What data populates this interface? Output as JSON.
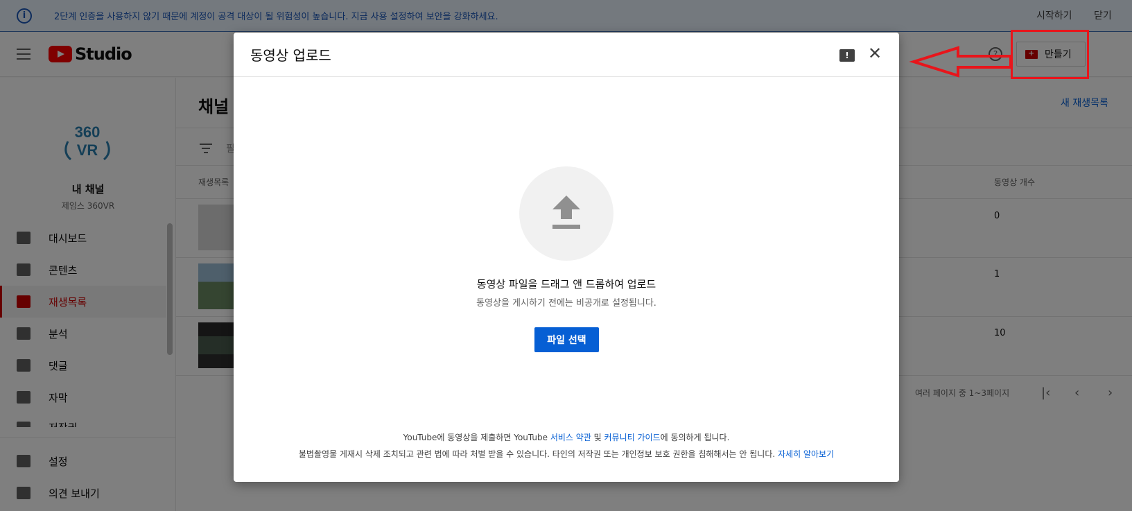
{
  "banner": {
    "message": "2단계 인증을 사용하지 않기 때문에 계정이 공격 대상이 될 위험성이 높습니다. 지금 사용 설정하여 보안을 강화하세요.",
    "start": "시작하기",
    "close": "닫기"
  },
  "header": {
    "logo_text": "Studio",
    "create_label": "만들기"
  },
  "sidebar": {
    "channel_title": "내 채널",
    "channel_name": "제임스 360VR",
    "avatar_text_top": "360",
    "avatar_text_bottom": "VR",
    "items": [
      {
        "label": "대시보드",
        "icon": "dashboard-icon"
      },
      {
        "label": "콘텐츠",
        "icon": "content-icon"
      },
      {
        "label": "재생목록",
        "icon": "playlist-icon"
      },
      {
        "label": "분석",
        "icon": "analytics-icon"
      },
      {
        "label": "댓글",
        "icon": "comments-icon"
      },
      {
        "label": "자막",
        "icon": "subtitles-icon"
      },
      {
        "label": "저작권",
        "icon": "copyright-icon"
      },
      {
        "label": "설정",
        "icon": "settings-icon"
      },
      {
        "label": "의견 보내기",
        "icon": "feedback-icon"
      }
    ]
  },
  "main": {
    "title": "채널",
    "new_playlist": "새 재생목록",
    "filter_placeholder": "필",
    "col_playlist": "재생목록",
    "col_video_count": "동영상 개수",
    "rows": [
      {
        "count": "0"
      },
      {
        "count": "1"
      },
      {
        "count": "10"
      }
    ],
    "pagination": "여러 페이지 중 1~3페이지"
  },
  "dialog": {
    "title": "동영상 업로드",
    "main_text": "동영상 파일을 드래그 앤 드롭하여 업로드",
    "sub_text": "동영상을 게시하기 전에는 비공개로 설정됩니다.",
    "select_button": "파일 선택",
    "legal1_prefix": "YouTube에 동영상을 제출하면 YouTube ",
    "legal1_link1": "서비스 약관",
    "legal1_mid": " 및 ",
    "legal1_link2": "커뮤니티 가이드",
    "legal1_suffix": "에 동의하게 됩니다.",
    "legal2_text": "불법촬영물 게재시 삭제 조치되고 관련 법에 따라 처벌 받을 수 있습니다. 타인의 저작권 또는 개인정보 보호 권한을 침해해서는 안 됩니다. ",
    "legal2_link": "자세히 알아보기"
  },
  "colors": {
    "accent_red": "#cc0000",
    "link_blue": "#065fd4",
    "annotation_red": "#e8151b"
  }
}
